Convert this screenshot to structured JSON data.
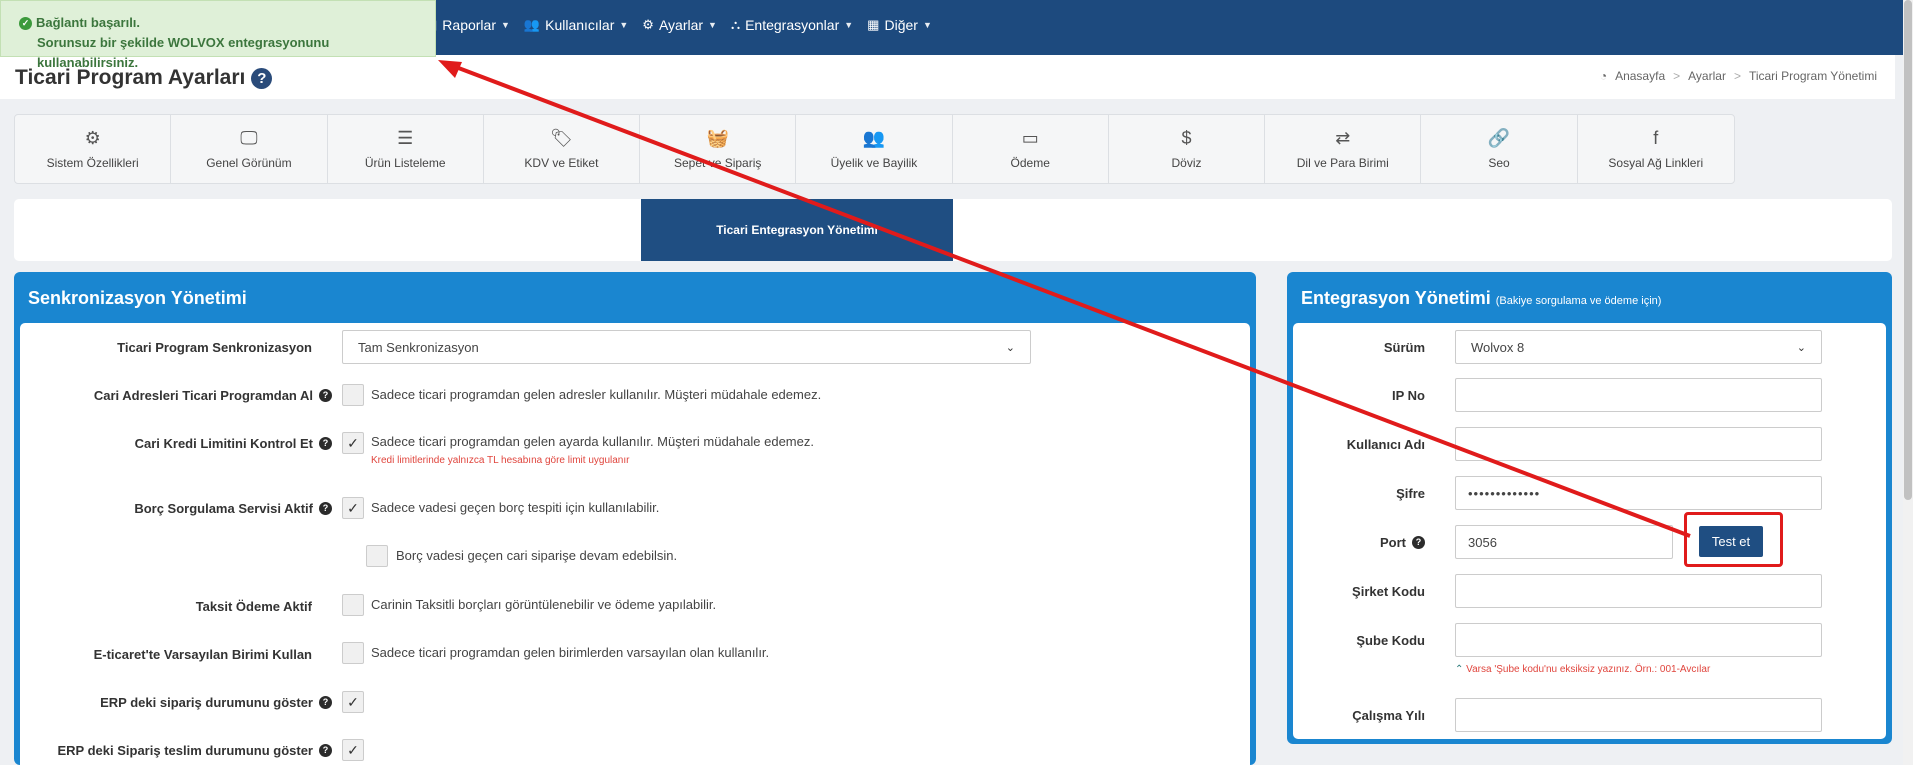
{
  "nav": {
    "items": [
      {
        "label": "Raporlar",
        "icon": "chart-icon"
      },
      {
        "label": "Kullanıcılar",
        "icon": "users-icon"
      },
      {
        "label": "Ayarlar",
        "icon": "gears-icon"
      },
      {
        "label": "Entegrasyonlar",
        "icon": "sitemap-icon"
      },
      {
        "label": "Diğer",
        "icon": "grid-icon"
      }
    ]
  },
  "alert": {
    "title": "Bağlantı başarılı.",
    "message": "Sorunsuz bir şekilde WOLVOX entegrasyonunu kullanabilirsiniz."
  },
  "page": {
    "title": "Ticari Program Ayarları",
    "breadcrumb": [
      "Anasayfa",
      "Ayarlar",
      "Ticari Program Yönetimi"
    ]
  },
  "tiles": [
    {
      "label": "Sistem Özellikleri",
      "icon": "gears-icon"
    },
    {
      "label": "Genel Görünüm",
      "icon": "monitor-icon"
    },
    {
      "label": "Ürün Listeleme",
      "icon": "list-icon"
    },
    {
      "label": "KDV ve Etiket",
      "icon": "tags-icon"
    },
    {
      "label": "Sepet ve Sipariş",
      "icon": "basket-icon"
    },
    {
      "label": "Üyelik ve Bayilik",
      "icon": "users-icon"
    },
    {
      "label": "Ödeme",
      "icon": "credit-card-icon"
    },
    {
      "label": "Döviz",
      "icon": "dollar-icon"
    },
    {
      "label": "Dil ve Para Birimi",
      "icon": "language-icon"
    },
    {
      "label": "Seo",
      "icon": "link-icon"
    },
    {
      "label": "Sosyal Ağ Linkleri",
      "icon": "facebook-icon"
    }
  ],
  "tabs": {
    "active": "Ticari Entegrasyon Yönetimi"
  },
  "sync": {
    "title": "Senkronizasyon Yönetimi",
    "rows": [
      {
        "label": "Ticari Program Senkronizasyon",
        "select": "Tam Senkronizasyon"
      },
      {
        "label": "Cari Adresleri Ticari Programdan Al",
        "checked": false,
        "text": "Sadece ticari programdan gelen adresler kullanılır. Müşteri müdahale edemez."
      },
      {
        "label": "Cari Kredi Limitini Kontrol Et",
        "checked": true,
        "text": "Sadece ticari programdan gelen ayarda kullanılır. Müşteri müdahale edemez.",
        "note": "Kredi limitlerinde yalnızca TL hesabına göre limit uygulanır"
      },
      {
        "label": "Borç Sorgulama Servisi Aktif",
        "checked": true,
        "text": "Sadece vadesi geçen borç tespiti için kullanılabilir."
      },
      {
        "label": "",
        "checked": false,
        "text": "Borç vadesi geçen cari siparişe devam edebilsin."
      },
      {
        "label": "Taksit Ödeme Aktif",
        "checked": false,
        "text": "Carinin Taksitli borçları görüntülenebilir ve ödeme yapılabilir."
      },
      {
        "label": "E-ticaret'te Varsayılan Birimi Kullan",
        "checked": false,
        "text": "Sadece ticari programdan gelen birimlerden varsayılan olan kullanılır."
      },
      {
        "label": "ERP deki sipariş durumunu göster",
        "checked": true,
        "text": ""
      },
      {
        "label": "ERP deki Sipariş teslim durumunu göster",
        "checked": true,
        "text": ""
      }
    ]
  },
  "integration": {
    "title": "Entegrasyon Yönetimi",
    "subtitle": "(Bakiye sorgulama ve ödeme için)",
    "fields": {
      "version_label": "Sürüm",
      "version_value": "Wolvox 8",
      "ip_label": "IP No",
      "ip_value": "",
      "user_label": "Kullanıcı Adı",
      "user_value": "",
      "password_label": "Şifre",
      "password_value": "•••••••••••••",
      "port_label": "Port",
      "port_value": "3056",
      "company_label": "Şirket Kodu",
      "company_value": "",
      "branch_label": "Şube Kodu",
      "branch_value": "",
      "branch_note": "Varsa 'Şube kodu'nu eksiksiz yazınız. Örn.: 001-Avcılar",
      "year_label": "Çalışma Yılı",
      "year_value": ""
    },
    "test_button": "Test et"
  },
  "colors": {
    "nav": "#1d4a7e",
    "panel": "#1a86d0",
    "alert_bg": "#dff0d8",
    "annotation": "#e01b1b"
  }
}
